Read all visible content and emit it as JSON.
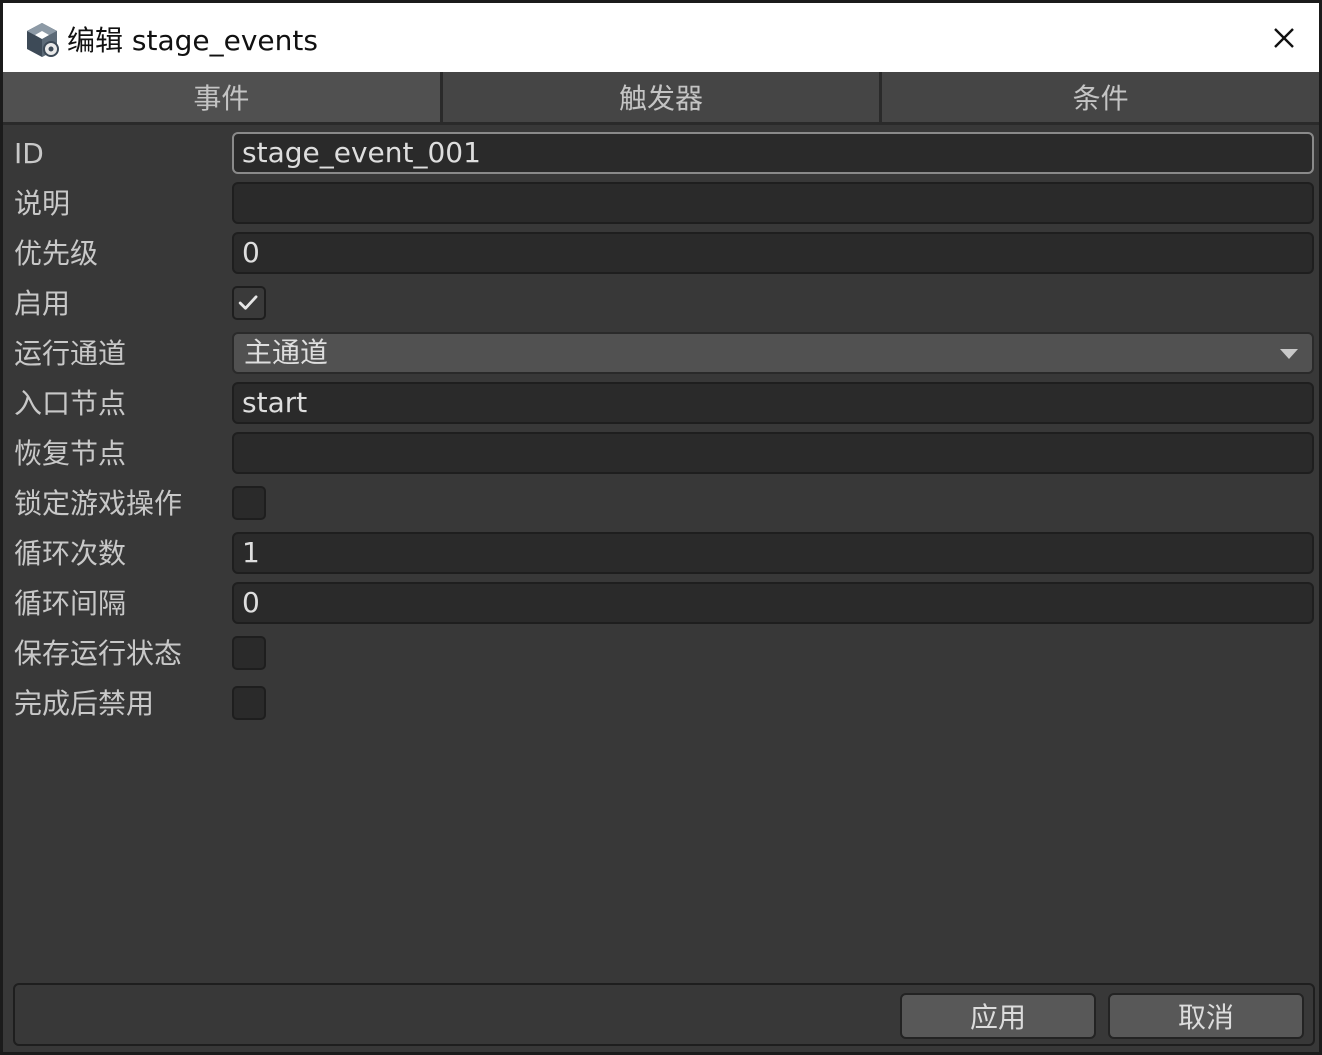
{
  "window": {
    "title": "编辑 stage_events",
    "app_icon": "unity-cube-icon",
    "close_icon": "close-icon"
  },
  "tabs": [
    {
      "label": "事件",
      "active": true
    },
    {
      "label": "触发器",
      "active": false
    },
    {
      "label": "条件",
      "active": false
    }
  ],
  "form": {
    "id": {
      "label": "ID",
      "value": "stage_event_001"
    },
    "description": {
      "label": "说明",
      "value": ""
    },
    "priority": {
      "label": "优先级",
      "value": "0"
    },
    "enabled": {
      "label": "启用",
      "checked": true
    },
    "channel": {
      "label": "运行通道",
      "value": "主通道"
    },
    "entry_node": {
      "label": "入口节点",
      "value": "start"
    },
    "resume_node": {
      "label": "恢复节点",
      "value": ""
    },
    "lock_input": {
      "label": "锁定游戏操作",
      "checked": false
    },
    "loop_count": {
      "label": "循环次数",
      "value": "1"
    },
    "loop_interval": {
      "label": "循环间隔",
      "value": "0"
    },
    "save_state": {
      "label": "保存运行状态",
      "checked": false
    },
    "disable_after": {
      "label": "完成后禁用",
      "checked": false
    }
  },
  "footer": {
    "apply_label": "应用",
    "cancel_label": "取消"
  },
  "colors": {
    "background": "#383838",
    "field": "#2a2a2a",
    "tab": "#454545",
    "button": "#585858"
  }
}
